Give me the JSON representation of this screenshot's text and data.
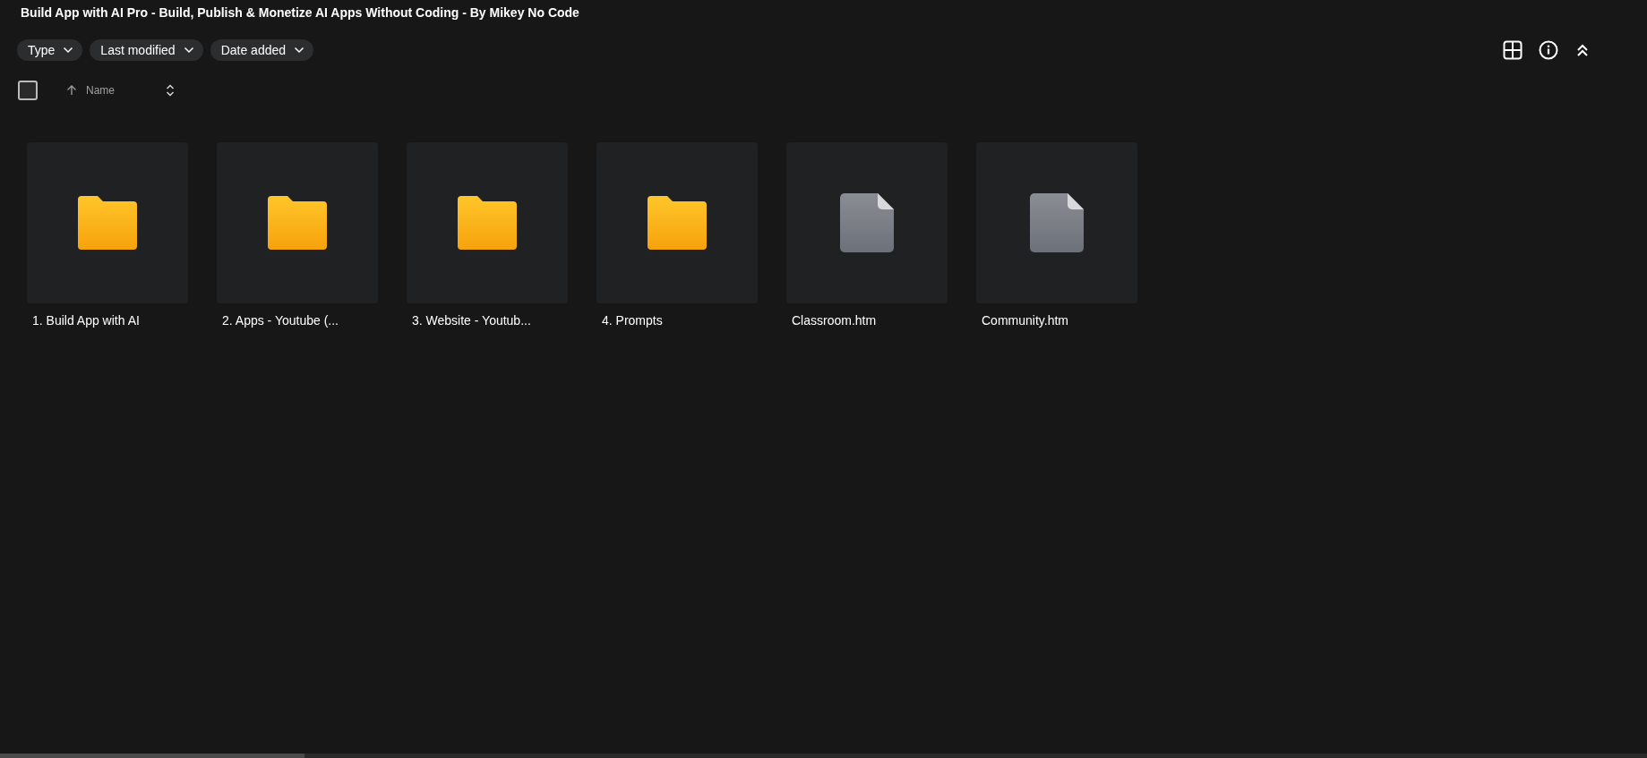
{
  "title": "Build App with AI Pro - Build, Publish & Monetize AI Apps Without Coding - By Mikey No Code",
  "filters": [
    "Type",
    "Last modified",
    "Date added"
  ],
  "select_all": {
    "checked": false
  },
  "sort": {
    "label": "Name"
  },
  "items": [
    {
      "kind": "folder",
      "name": "1. Build App with AI"
    },
    {
      "kind": "folder",
      "name": "2. Apps - Youtube (..."
    },
    {
      "kind": "folder",
      "name": "3. Website - Youtub..."
    },
    {
      "kind": "folder",
      "name": "4. Prompts"
    },
    {
      "kind": "file",
      "name": "Classroom.htm"
    },
    {
      "kind": "file",
      "name": "Community.htm"
    }
  ]
}
